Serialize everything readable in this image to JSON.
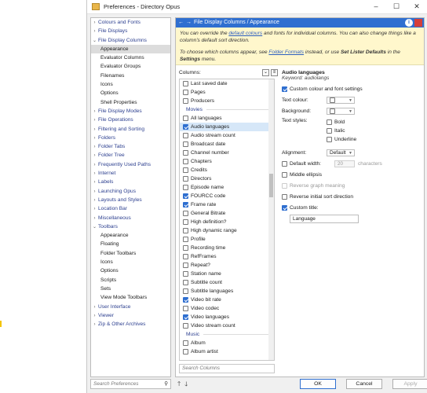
{
  "window": {
    "title": "Preferences - Directory Opus"
  },
  "tree": [
    {
      "label": "Colours and Fonts",
      "level": 0,
      "arrow": "›"
    },
    {
      "label": "File Displays",
      "level": 0,
      "arrow": "›"
    },
    {
      "label": "File Display Columns",
      "level": 0,
      "arrow": "⌄"
    },
    {
      "label": "Appearance",
      "level": 1,
      "selected": true
    },
    {
      "label": "Evaluator Columns",
      "level": 1
    },
    {
      "label": "Evaluator Groups",
      "level": 1
    },
    {
      "label": "Filenames",
      "level": 1
    },
    {
      "label": "Icons",
      "level": 1
    },
    {
      "label": "Options",
      "level": 1
    },
    {
      "label": "Shell Properties",
      "level": 1
    },
    {
      "label": "File Display Modes",
      "level": 0,
      "arrow": "›"
    },
    {
      "label": "File Operations",
      "level": 0,
      "arrow": "›"
    },
    {
      "label": "Filtering and Sorting",
      "level": 0,
      "arrow": "›"
    },
    {
      "label": "Folders",
      "level": 0,
      "arrow": "›"
    },
    {
      "label": "Folder Tabs",
      "level": 0,
      "arrow": "›"
    },
    {
      "label": "Folder Tree",
      "level": 0,
      "arrow": "›"
    },
    {
      "label": "Frequently Used Paths",
      "level": 0,
      "arrow": "›"
    },
    {
      "label": "Internet",
      "level": 0,
      "arrow": "›"
    },
    {
      "label": "Labels",
      "level": 0,
      "arrow": "›"
    },
    {
      "label": "Launching Opus",
      "level": 0,
      "arrow": "›"
    },
    {
      "label": "Layouts and Styles",
      "level": 0,
      "arrow": "›"
    },
    {
      "label": "Location Bar",
      "level": 0,
      "arrow": "›"
    },
    {
      "label": "Miscellaneous",
      "level": 0,
      "arrow": "›"
    },
    {
      "label": "Toolbars",
      "level": 0,
      "arrow": "⌄"
    },
    {
      "label": "Appearance",
      "level": 1
    },
    {
      "label": "Floating",
      "level": 1
    },
    {
      "label": "Folder Toolbars",
      "level": 1
    },
    {
      "label": "Icons",
      "level": 1
    },
    {
      "label": "Options",
      "level": 1
    },
    {
      "label": "Scripts",
      "level": 1
    },
    {
      "label": "Sets",
      "level": 1
    },
    {
      "label": "View Mode Toolbars",
      "level": 1
    },
    {
      "label": "User Interface",
      "level": 0,
      "arrow": "›"
    },
    {
      "label": "Viewer",
      "level": 0,
      "arrow": "›"
    },
    {
      "label": "Zip & Other Archives",
      "level": 0,
      "arrow": "›"
    }
  ],
  "search_prefs": {
    "placeholder": "Search Preferences"
  },
  "header": {
    "breadcrumb": "File Display Columns / Appearance"
  },
  "description": {
    "p1_a": "You can override the ",
    "p1_link": "default colours",
    "p1_b": " and fonts for individual columns. You can also change things like a column's default sort direction.",
    "p2_a": "To choose which columns appear, see ",
    "p2_link": "Folder Formats",
    "p2_b": " instead, or use ",
    "p2_bold": "Set Lister Defaults",
    "p2_c": " in the ",
    "p2_bold2": "Settings",
    "p2_d": " menu."
  },
  "columns_label": "Columns:",
  "columns": [
    {
      "label": "Last saved date",
      "checked": false
    },
    {
      "label": "Pages",
      "checked": false
    },
    {
      "label": "Producers",
      "checked": false
    },
    {
      "label": "Movies",
      "group": true
    },
    {
      "label": "All languages",
      "checked": false
    },
    {
      "label": "Audio languages",
      "checked": true,
      "selected": true
    },
    {
      "label": "Audio stream count",
      "checked": false
    },
    {
      "label": "Broadcast date",
      "checked": false
    },
    {
      "label": "Channel number",
      "checked": false
    },
    {
      "label": "Chapters",
      "checked": false
    },
    {
      "label": "Credits",
      "checked": false
    },
    {
      "label": "Directors",
      "checked": false
    },
    {
      "label": "Episode name",
      "checked": false
    },
    {
      "label": "FOURCC code",
      "checked": true
    },
    {
      "label": "Frame rate",
      "checked": true
    },
    {
      "label": "General Bitrate",
      "checked": false
    },
    {
      "label": "High definition?",
      "checked": false
    },
    {
      "label": "High dynamic range",
      "checked": false
    },
    {
      "label": "Profile",
      "checked": false
    },
    {
      "label": "Recording time",
      "checked": false
    },
    {
      "label": "RefFrames",
      "checked": false
    },
    {
      "label": "Repeat?",
      "checked": false
    },
    {
      "label": "Station name",
      "checked": false
    },
    {
      "label": "Subtitle count",
      "checked": false
    },
    {
      "label": "Subtitle languages",
      "checked": false
    },
    {
      "label": "Video bit rate",
      "checked": true
    },
    {
      "label": "Video codec",
      "checked": false
    },
    {
      "label": "Video languages",
      "checked": true
    },
    {
      "label": "Video stream count",
      "checked": false
    },
    {
      "label": "Music",
      "group": true
    },
    {
      "label": "Album",
      "checked": false
    },
    {
      "label": "Album artist",
      "checked": false
    }
  ],
  "columns_search": {
    "placeholder": "Search Columns"
  },
  "props": {
    "title": "Audio languages",
    "keyword": "Keyword: audiolangs",
    "custom_colour_font": "Custom colour and font settings",
    "text_colour": "Text colour:",
    "background": "Background:",
    "text_styles": "Text styles:",
    "bold": "Bold",
    "italic": "Italic",
    "underline": "Underline",
    "alignment": "Alignment:",
    "alignment_value": "Default",
    "default_width": "Default width:",
    "width_value": "20",
    "width_unit": "characters",
    "middle_ellipsis": "Middle ellipsis",
    "reverse_graph": "Reverse graph meaning",
    "reverse_sort": "Reverse initial sort direction",
    "custom_title": "Custom title:",
    "custom_title_value": "Language"
  },
  "buttons": {
    "ok": "OK",
    "cancel": "Cancel",
    "apply": "Apply"
  },
  "colors": {
    "accent": "#2f6fd0",
    "desc_bg": "#fff7cc",
    "tree_link": "#2c3f8f"
  }
}
